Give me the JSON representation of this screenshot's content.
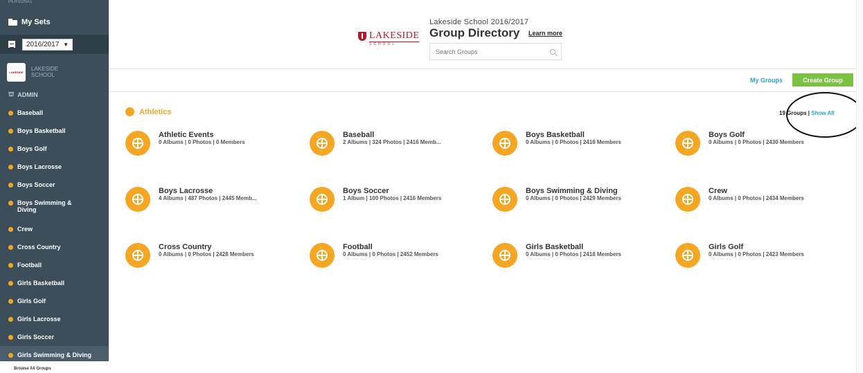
{
  "sidebar": {
    "personal_label": "PERSONAL",
    "my_sets_label": "My Sets",
    "year_select": "2016/2017",
    "school_logo_text": "LAKESIDE",
    "school_name": "LAKESIDE SCHOOL",
    "admin_label": "ADMIN",
    "items": [
      {
        "label": "Baseball"
      },
      {
        "label": "Boys Basketball"
      },
      {
        "label": "Boys Golf"
      },
      {
        "label": "Boys Lacrosse"
      },
      {
        "label": "Boys Soccer"
      },
      {
        "label": "Boys Swimming & Diving"
      },
      {
        "label": "Crew"
      },
      {
        "label": "Cross Country"
      },
      {
        "label": "Football"
      },
      {
        "label": "Girls Basketball"
      },
      {
        "label": "Girls Golf"
      },
      {
        "label": "Girls Lacrosse"
      },
      {
        "label": "Girls Soccer"
      },
      {
        "label": "Girls Swimming & Diving"
      }
    ],
    "browse_all": "Browse All Groups"
  },
  "header": {
    "brand": "LAKESIDE",
    "brand_sub": "SCHOOL",
    "subtitle": "Lakeside School 2016/2017",
    "title": "Group Directory",
    "learn_more": "Learn more",
    "search_placeholder": "Search Groups"
  },
  "toolbar": {
    "my_groups": "My Groups",
    "create_group": "Create Group"
  },
  "section": {
    "title": "Athletics",
    "count_text": "19 Groups | ",
    "show_all": "Show All"
  },
  "groups": [
    {
      "name": "Athletic Events",
      "meta": "0 Albums | 0 Photos | 0 Members"
    },
    {
      "name": "Baseball",
      "meta": "2 Albums | 324 Photos | 2416 Memb..."
    },
    {
      "name": "Boys Basketball",
      "meta": "0 Albums | 0 Photos | 2416 Members"
    },
    {
      "name": "Boys Golf",
      "meta": "0 Albums | 0 Photos | 2430 Members"
    },
    {
      "name": "Boys Lacrosse",
      "meta": "4 Albums | 487 Photos | 2445 Memb..."
    },
    {
      "name": "Boys Soccer",
      "meta": "1 Album | 100 Photos | 2416 Members"
    },
    {
      "name": "Boys Swimming & Diving",
      "meta": "0 Albums | 0 Photos | 2429 Members"
    },
    {
      "name": "Crew",
      "meta": "0 Albums | 0 Photos | 2434 Members"
    },
    {
      "name": "Cross Country",
      "meta": "0 Albums | 0 Photos | 2428 Members"
    },
    {
      "name": "Football",
      "meta": "0 Albums | 0 Photos | 2452 Members"
    },
    {
      "name": "Girls Basketball",
      "meta": "0 Albums | 0 Photos | 2418 Members"
    },
    {
      "name": "Girls Golf",
      "meta": "0 Albums | 0 Photos | 2423 Members"
    }
  ],
  "colors": {
    "sidebar_bg": "#3c4e5a",
    "accent_orange": "#f5a623",
    "link_blue": "#2a9fd6",
    "create_green": "#7dc142",
    "brand_red": "#b4192b"
  }
}
